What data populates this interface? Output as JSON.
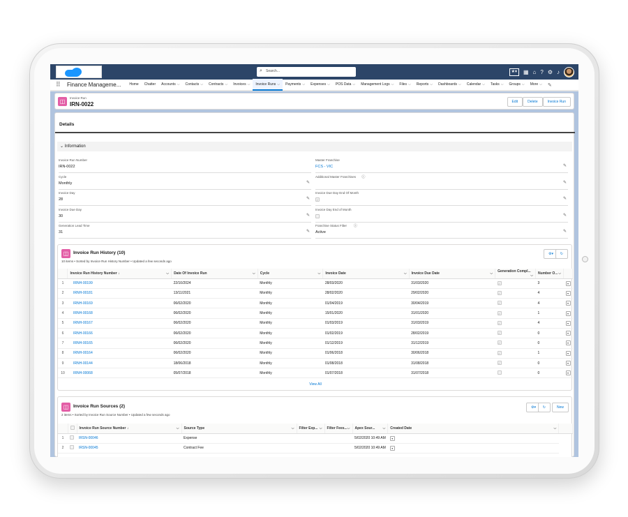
{
  "header": {
    "search_placeholder": "Search..."
  },
  "nav": {
    "app_name": "Finance Manageme...",
    "items": [
      {
        "label": "Home",
        "dropdown": false
      },
      {
        "label": "Chatter",
        "dropdown": false
      },
      {
        "label": "Accounts",
        "dropdown": true
      },
      {
        "label": "Contacts",
        "dropdown": true
      },
      {
        "label": "Contracts",
        "dropdown": true
      },
      {
        "label": "Invoices",
        "dropdown": true
      },
      {
        "label": "Invoice Runs",
        "dropdown": true,
        "active": true
      },
      {
        "label": "Payments",
        "dropdown": true
      },
      {
        "label": "Expenses",
        "dropdown": true
      },
      {
        "label": "POS Data",
        "dropdown": true
      },
      {
        "label": "Management Logs",
        "dropdown": true
      },
      {
        "label": "Files",
        "dropdown": true
      },
      {
        "label": "Reports",
        "dropdown": true
      },
      {
        "label": "Dashboards",
        "dropdown": true
      },
      {
        "label": "Calendar",
        "dropdown": true
      },
      {
        "label": "Tasks",
        "dropdown": true
      },
      {
        "label": "Groups",
        "dropdown": true
      },
      {
        "label": "More",
        "dropdown": true
      }
    ]
  },
  "record": {
    "object_label": "Invoice Run",
    "name": "IRN-0022",
    "buttons": {
      "edit": "Edit",
      "delete": "Delete",
      "invoice_run": "Invoice Run"
    }
  },
  "details": {
    "tab": "Details",
    "section": "Information",
    "left": [
      {
        "label": "Invoice Run Number",
        "value": "IRN-0022",
        "editable": false
      },
      {
        "label": "Cycle",
        "value": "Monthly",
        "editable": true
      },
      {
        "label": "Invoice Day",
        "value": "28",
        "editable": true
      },
      {
        "label": "Invoice Due Day",
        "value": "30",
        "editable": true
      },
      {
        "label": "Generation Lead Time",
        "value": "31",
        "editable": true
      }
    ],
    "right": [
      {
        "label": "Master Franchise",
        "value": "FCS - VIC",
        "link": true
      },
      {
        "label": "Additional Master Franchises",
        "value": "",
        "info": true
      },
      {
        "label": "Invoice Due Day End Of Month",
        "checkbox": true,
        "checked": true
      },
      {
        "label": "Invoice Day End of Month",
        "checkbox": true,
        "checked": false
      },
      {
        "label": "Franchise Status Filter",
        "value": "Active",
        "info": true
      }
    ]
  },
  "history": {
    "title": "Invoice Run History (10)",
    "subtitle": "10 items • Sorted by Invoice Run History Number • Updated a few seconds ago",
    "columns": [
      "Invoice Run History Number ↓",
      "Date Of Invoice Run",
      "Cycle",
      "Invoice Date",
      "Invoice Due Date",
      "Generation Compl...",
      "Number O..."
    ],
    "rows": [
      [
        "1",
        "IRNH-00199",
        "22/10/2024",
        "Monthly",
        "28/03/2020",
        "31/03/2020",
        "3"
      ],
      [
        "2",
        "IRNH-00181",
        "13/11/2021",
        "Monthly",
        "28/02/2020",
        "29/02/2020",
        "4"
      ],
      [
        "3",
        "IRNH-00169",
        "06/02/2020",
        "Monthly",
        "01/04/2019",
        "30/04/2019",
        "4"
      ],
      [
        "4",
        "IRNH-00168",
        "06/02/2020",
        "Monthly",
        "15/01/2020",
        "31/01/2020",
        "1"
      ],
      [
        "5",
        "IRNH-00167",
        "06/02/2020",
        "Monthly",
        "01/03/2019",
        "31/03/2019",
        "4"
      ],
      [
        "6",
        "IRNH-00166",
        "06/02/2020",
        "Monthly",
        "01/02/2019",
        "28/02/2019",
        "0"
      ],
      [
        "7",
        "IRNH-00165",
        "06/02/2020",
        "Monthly",
        "01/12/2019",
        "31/12/2019",
        "0"
      ],
      [
        "8",
        "IRNH-00164",
        "06/02/2020",
        "Monthly",
        "01/06/2018",
        "30/06/2018",
        "1"
      ],
      [
        "9",
        "IRNH-00144",
        "18/06/2018",
        "Monthly",
        "01/08/2018",
        "31/08/2018",
        "0"
      ],
      [
        "10",
        "IRNH-00068",
        "05/07/2018",
        "Monthly",
        "01/07/2018",
        "31/07/2018",
        "0"
      ]
    ],
    "checked": [
      true,
      true,
      true,
      true,
      true,
      true,
      true,
      true,
      true,
      false
    ],
    "view_all": "View All"
  },
  "sources": {
    "title": "Invoice Run Sources (2)",
    "subtitle": "2 items • Sorted by Invoice Run Source Number • Updated a few seconds ago",
    "new_button": "New",
    "columns": [
      "Invoice Run Source Number ↓",
      "Source Type",
      "Filter Exp...",
      "Filter Fees...",
      "Apex Sour...",
      "Created Date"
    ],
    "rows": [
      [
        "1",
        "IRSN-00046",
        "Expense",
        "",
        "",
        "5/02/2020 10:49 AM"
      ],
      [
        "2",
        "IRSN-00045",
        "Contract Fee",
        "",
        "",
        "5/02/2020 10:49 AM"
      ]
    ]
  }
}
